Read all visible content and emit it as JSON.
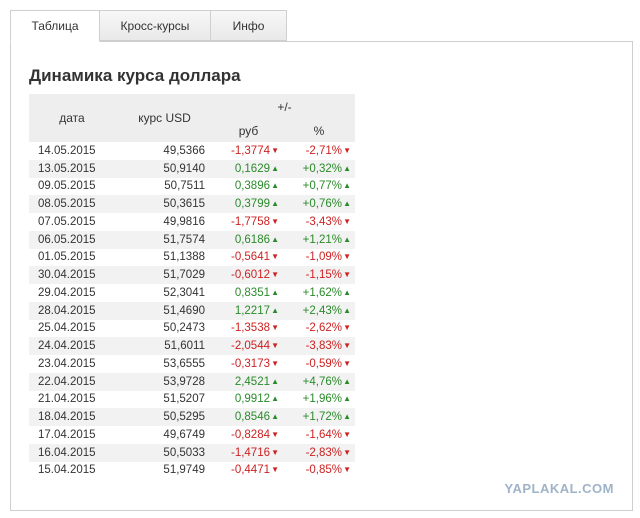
{
  "tabs": [
    {
      "label": "Таблица",
      "active": true
    },
    {
      "label": "Кросс-курсы",
      "active": false
    },
    {
      "label": "Инфо",
      "active": false
    }
  ],
  "title": "Динамика курса доллара",
  "table": {
    "headers": {
      "date": "дата",
      "usd": "курс USD",
      "change": "+/-",
      "rub": "руб",
      "pct": "%"
    },
    "rows": [
      {
        "date": "14.05.2015",
        "usd": "49,5366",
        "rub": "-1,3774",
        "pct": "-2,71%",
        "dir": "down"
      },
      {
        "date": "13.05.2015",
        "usd": "50,9140",
        "rub": "0,1629",
        "pct": "+0,32%",
        "dir": "up"
      },
      {
        "date": "09.05.2015",
        "usd": "50,7511",
        "rub": "0,3896",
        "pct": "+0,77%",
        "dir": "up"
      },
      {
        "date": "08.05.2015",
        "usd": "50,3615",
        "rub": "0,3799",
        "pct": "+0,76%",
        "dir": "up"
      },
      {
        "date": "07.05.2015",
        "usd": "49,9816",
        "rub": "-1,7758",
        "pct": "-3,43%",
        "dir": "down"
      },
      {
        "date": "06.05.2015",
        "usd": "51,7574",
        "rub": "0,6186",
        "pct": "+1,21%",
        "dir": "up"
      },
      {
        "date": "01.05.2015",
        "usd": "51,1388",
        "rub": "-0,5641",
        "pct": "-1,09%",
        "dir": "down"
      },
      {
        "date": "30.04.2015",
        "usd": "51,7029",
        "rub": "-0,6012",
        "pct": "-1,15%",
        "dir": "down"
      },
      {
        "date": "29.04.2015",
        "usd": "52,3041",
        "rub": "0,8351",
        "pct": "+1,62%",
        "dir": "up"
      },
      {
        "date": "28.04.2015",
        "usd": "51,4690",
        "rub": "1,2217",
        "pct": "+2,43%",
        "dir": "up"
      },
      {
        "date": "25.04.2015",
        "usd": "50,2473",
        "rub": "-1,3538",
        "pct": "-2,62%",
        "dir": "down"
      },
      {
        "date": "24.04.2015",
        "usd": "51,6011",
        "rub": "-2,0544",
        "pct": "-3,83%",
        "dir": "down"
      },
      {
        "date": "23.04.2015",
        "usd": "53,6555",
        "rub": "-0,3173",
        "pct": "-0,59%",
        "dir": "down"
      },
      {
        "date": "22.04.2015",
        "usd": "53,9728",
        "rub": "2,4521",
        "pct": "+4,76%",
        "dir": "up"
      },
      {
        "date": "21.04.2015",
        "usd": "51,5207",
        "rub": "0,9912",
        "pct": "+1,96%",
        "dir": "up"
      },
      {
        "date": "18.04.2015",
        "usd": "50,5295",
        "rub": "0,8546",
        "pct": "+1,72%",
        "dir": "up"
      },
      {
        "date": "17.04.2015",
        "usd": "49,6749",
        "rub": "-0,8284",
        "pct": "-1,64%",
        "dir": "down"
      },
      {
        "date": "16.04.2015",
        "usd": "50,5033",
        "rub": "-1,4716",
        "pct": "-2,83%",
        "dir": "down"
      },
      {
        "date": "15.04.2015",
        "usd": "51,9749",
        "rub": "-0,4471",
        "pct": "-0,85%",
        "dir": "down"
      }
    ]
  },
  "colors": {
    "up": "#2a8a2a",
    "down": "#cc2222"
  },
  "icons": {
    "up": "triangle-up-icon",
    "down": "triangle-down-icon"
  },
  "watermark": "YAPLAKAL.COM"
}
